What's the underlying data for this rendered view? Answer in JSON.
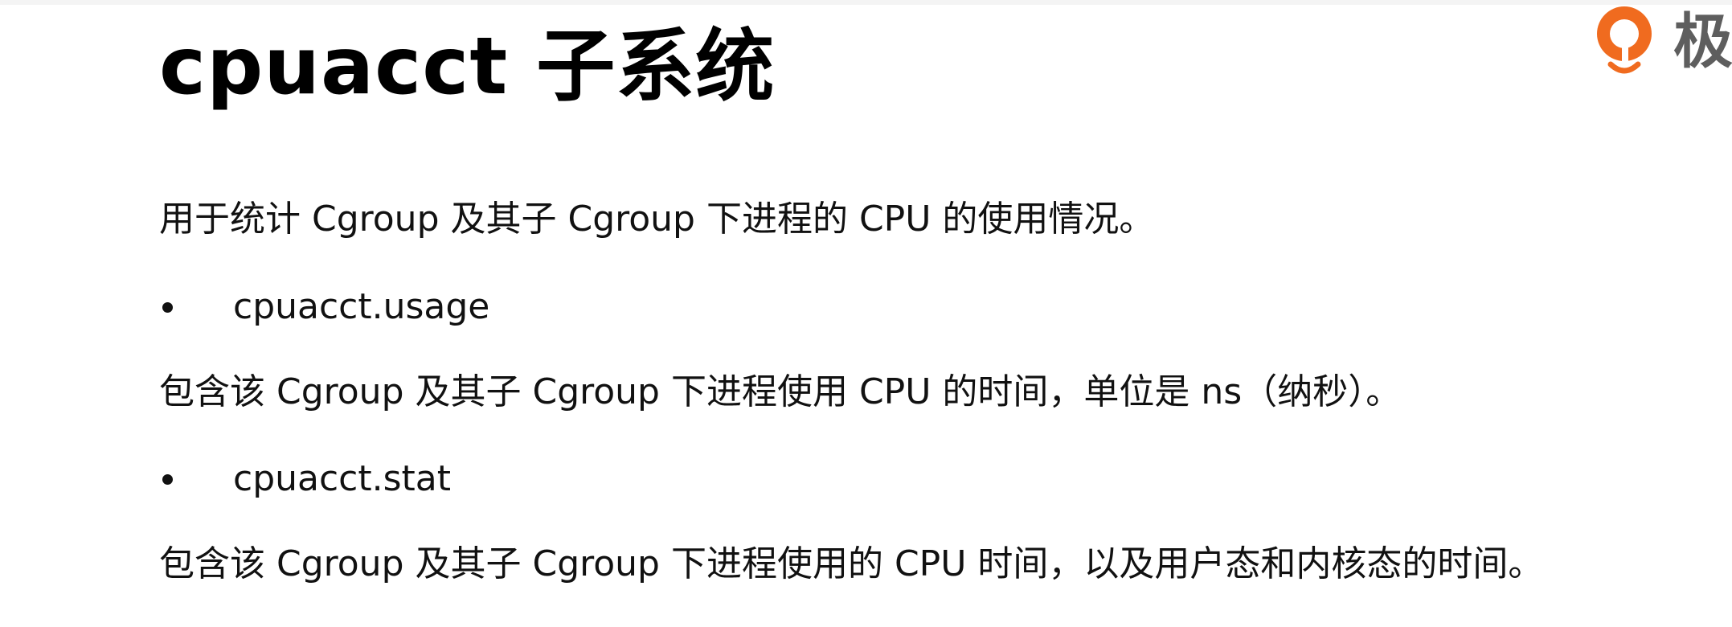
{
  "slide": {
    "title": "cpuacct 子系统",
    "intro": "用于统计 Cgroup 及其子 Cgroup 下进程的 CPU 的使用情况。",
    "items": [
      {
        "name": "cpuacct.usage",
        "description": "包含该 Cgroup 及其子 Cgroup 下进程使用 CPU 的时间，单位是 ns（纳秒）。"
      },
      {
        "name": "cpuacct.stat",
        "description": "包含该 Cgroup 及其子 Cgroup 下进程使用的 CPU 时间，以及用户态和内核态的时间。"
      }
    ]
  },
  "brand": {
    "logo_icon": "geekbang-logo-icon",
    "text": "极",
    "color": "#f06b1f"
  }
}
